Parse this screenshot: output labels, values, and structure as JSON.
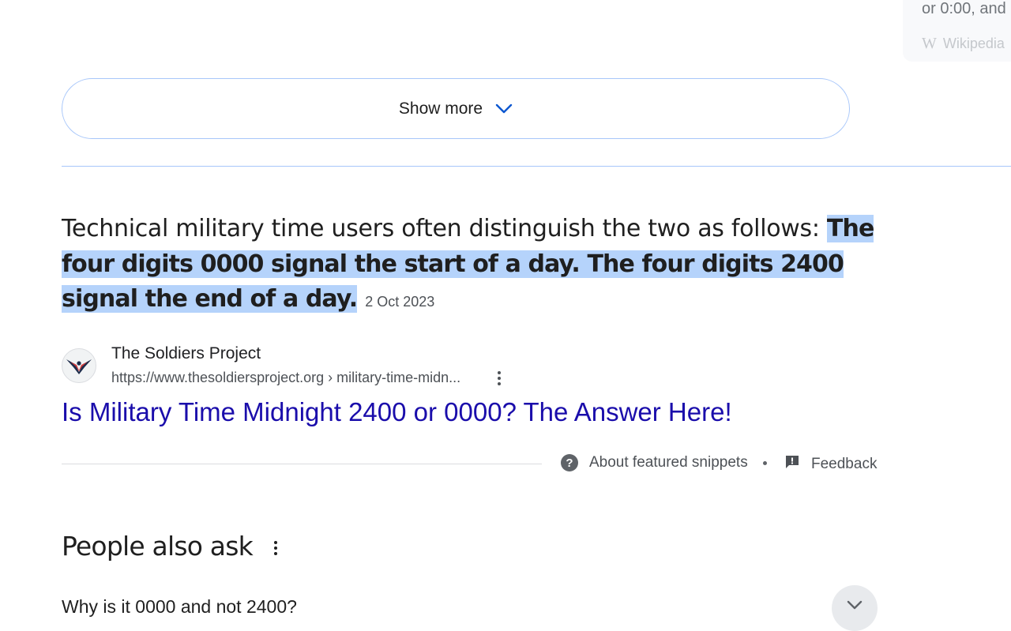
{
  "knowledge_panel": {
    "text": "or 0:00, and",
    "source_label": "Wikipedia",
    "source_icon": "wikipedia-icon"
  },
  "show_more": {
    "label": "Show more",
    "icon": "chevron-down-icon"
  },
  "snippet": {
    "intro": "Technical military time users often distinguish the two as follows: ",
    "highlight": "The four digits 0000 signal the start of a day. The four digits 2400 signal the end of a day.",
    "date": "2 Oct 2023"
  },
  "source": {
    "name": "The Soldiers Project",
    "url": "https://www.thesoldiersproject.org › military-time-midn...",
    "favicon": "soldiers-project-logo"
  },
  "result": {
    "title": "Is Military Time Midnight 2400 or 0000? The Answer Here!"
  },
  "footer": {
    "about_label": "About featured snippets",
    "separator": "•",
    "feedback_label": "Feedback"
  },
  "people_also_ask": {
    "heading": "People also ask",
    "questions": [
      "Why is it 0000 and not 2400?"
    ]
  },
  "colors": {
    "link": "#1a0dab",
    "highlight": "#b5d3fb",
    "border_blue": "#a8c7fa"
  }
}
